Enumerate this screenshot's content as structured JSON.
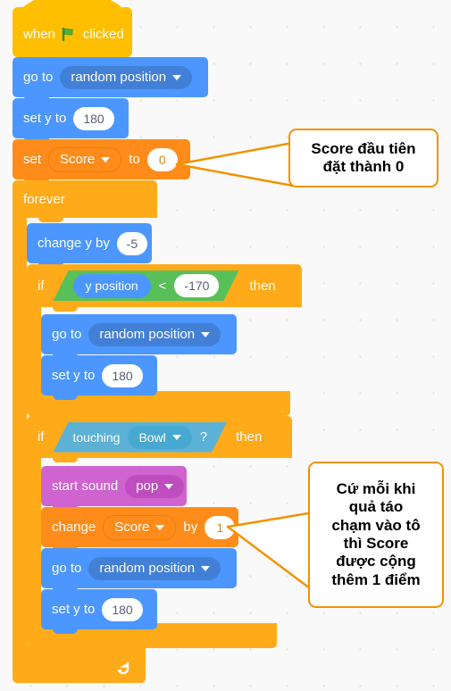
{
  "app": {
    "name": "Scratch block script canvas",
    "background": "#f9f9f9"
  },
  "palette": {
    "events": "#FFBF00",
    "motion": "#4C97FF",
    "motion_dark": "#4280D7",
    "variables": "#FF8C1A",
    "control": "#FFAB19",
    "operators": "#59C059",
    "sensing": "#5CB1D6",
    "sound": "#CF63CF",
    "callout_border": "#F39200",
    "input_text": "#575E75"
  },
  "script": {
    "hat": {
      "word_when": "when",
      "flag_icon": "green-flag-icon",
      "word_clicked": "clicked"
    },
    "goto_1": {
      "label": "go to",
      "dropdown": "random position",
      "caret": "chevron-down-icon"
    },
    "sety_1": {
      "label": "set y to",
      "value": "180"
    },
    "set_var": {
      "label_set": "set",
      "variable": "Score",
      "label_to": "to",
      "value": "0",
      "caret": "chevron-down-icon"
    },
    "forever": {
      "label": "forever",
      "loop_icon": "loop-arrow-icon"
    },
    "change_y": {
      "label": "change y by",
      "value": "-5"
    },
    "if_1": {
      "label_if": "if",
      "label_then": "then",
      "condition": {
        "reporter": "y position",
        "operator": "<",
        "value": "-170"
      },
      "body": {
        "goto": {
          "label": "go to",
          "dropdown": "random position",
          "caret": "chevron-down-icon"
        },
        "sety": {
          "label": "set y to",
          "value": "180"
        }
      }
    },
    "if_2": {
      "label_if": "if",
      "label_then": "then",
      "condition": {
        "label_touching": "touching",
        "dropdown": "Bowl",
        "question": "?",
        "caret": "chevron-down-icon"
      },
      "body": {
        "start_sound": {
          "label": "start sound",
          "dropdown": "pop",
          "caret": "chevron-down-icon"
        },
        "change_var": {
          "label_change": "change",
          "variable": "Score",
          "label_by": "by",
          "value": "1",
          "caret": "chevron-down-icon"
        },
        "goto": {
          "label": "go to",
          "dropdown": "random position",
          "caret": "chevron-down-icon"
        },
        "sety": {
          "label": "set y to",
          "value": "180"
        }
      }
    }
  },
  "callouts": [
    {
      "id": "callout-score-init",
      "line1": "Score đầu tiên",
      "line2": "đặt thành 0"
    },
    {
      "id": "callout-score-increment",
      "line1": "Cứ mỗi khi",
      "line2": "quả táo",
      "line3": "chạm vào tô",
      "line4": "thì Score",
      "line5": "được cộng",
      "line6": "thêm 1 điểm"
    }
  ]
}
